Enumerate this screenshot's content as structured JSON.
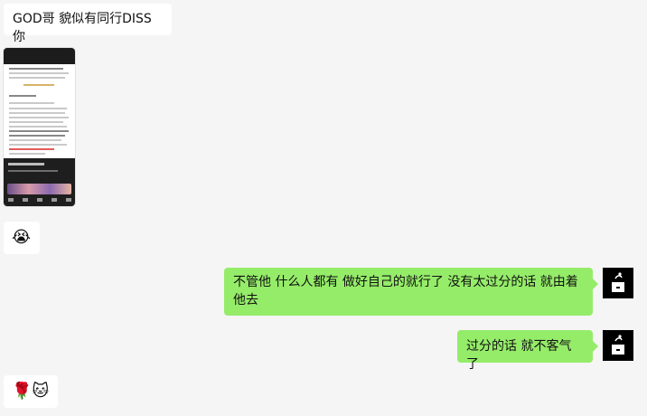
{
  "messages": [
    {
      "id": "m1",
      "direction": "incoming",
      "text": "GOD哥 貌似有同行DISS你"
    },
    {
      "id": "m2",
      "direction": "incoming",
      "type": "image",
      "description_icon": "phone-screenshot-icon"
    },
    {
      "id": "m3",
      "direction": "incoming",
      "emoji": "😭"
    },
    {
      "id": "m4",
      "direction": "outgoing",
      "text": "不管他 什么人都有  做好自己的就行了  没有太过分的话 就由着他去"
    },
    {
      "id": "m5",
      "direction": "outgoing",
      "text": "过分的话 就不客气了"
    },
    {
      "id": "m6",
      "direction": "incoming",
      "emoji": "🌹🐱"
    }
  ],
  "colors": {
    "background": "#f5f5f5",
    "incoming_bubble": "#ffffff",
    "outgoing_bubble": "#95ec69",
    "avatar": "#000000"
  }
}
